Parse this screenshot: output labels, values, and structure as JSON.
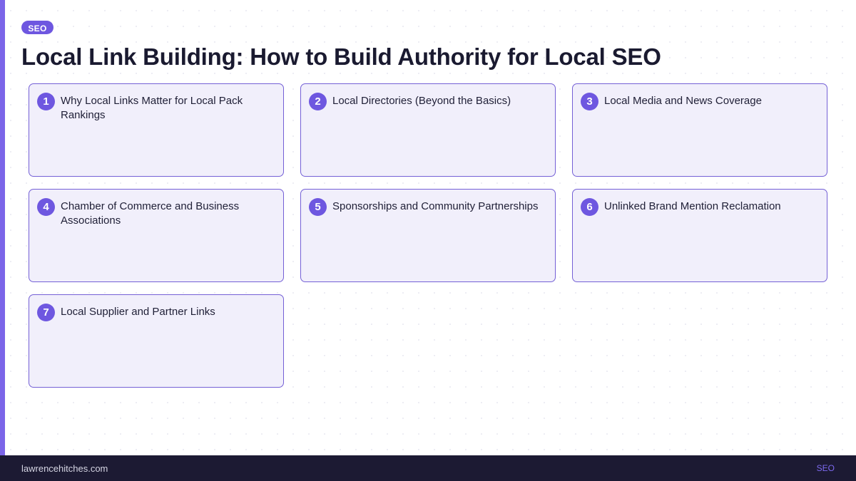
{
  "header": {
    "tag": "SEO",
    "title": "Local Link Building: How to Build Authority for Local SEO"
  },
  "cards": [
    {
      "number": "1",
      "title": "Why Local Links Matter for Local Pack Rankings"
    },
    {
      "number": "2",
      "title": "Local Directories (Beyond the Basics)"
    },
    {
      "number": "3",
      "title": "Local Media and News Coverage"
    },
    {
      "number": "4",
      "title": "Chamber of Commerce and Business Associations"
    },
    {
      "number": "5",
      "title": "Sponsorships and Community Partnerships"
    },
    {
      "number": "6",
      "title": "Unlinked Brand Mention Reclamation"
    },
    {
      "number": "7",
      "title": "Local Supplier and Partner Links"
    }
  ],
  "footer": {
    "site": "lawrencehitches.com",
    "tag": "SEO"
  },
  "colors": {
    "accent": "#6e57e0",
    "card_background": "#f1effb",
    "card_border": "#7460d6",
    "footer_background": "#1c1a33"
  }
}
